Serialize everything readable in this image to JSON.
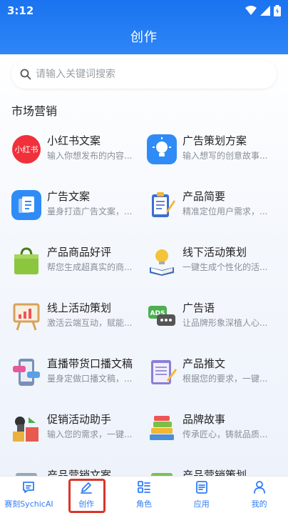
{
  "status_bar": {
    "time": "3:12"
  },
  "header": {
    "title": "创作"
  },
  "search": {
    "placeholder": "请输入关键词搜索"
  },
  "section": {
    "title": "市场营销"
  },
  "cards": [
    {
      "title": "小红书文案",
      "desc": "输入你想发布的内容...",
      "icon": "xiaohongshu-icon",
      "color": "#f0303a",
      "badge": "小红书"
    },
    {
      "title": "广告策划方案",
      "desc": "输入想写的创意故事...",
      "icon": "lightbulb-icon",
      "color": "#2f8cf7"
    },
    {
      "title": "广告文案",
      "desc": "量身打造广告文案，...",
      "icon": "documents-icon",
      "color": "#2f8cf7"
    },
    {
      "title": "产品简要",
      "desc": "精准定位用户需求，...",
      "icon": "clipboard-icon",
      "color": "#3d6fd0"
    },
    {
      "title": "产品商品好评",
      "desc": "帮您生成超真实的商...",
      "icon": "shopping-bag-icon",
      "color": "#8cc63e"
    },
    {
      "title": "线下活动策划",
      "desc": "一键生成个性化的活...",
      "icon": "idea-book-icon",
      "color": "#f3c338"
    },
    {
      "title": "线上活动策划",
      "desc": "激活云端互动，赋能...",
      "icon": "presentation-board-icon",
      "color": "#d9a25a"
    },
    {
      "title": "广告语",
      "desc": "让品牌形象深植人心...",
      "icon": "ads-chat-icon",
      "color": "#4caf50",
      "badge": "ADS"
    },
    {
      "title": "直播带货口播文稿",
      "desc": "量身定做口播文稿，...",
      "icon": "phone-chat-icon",
      "color": "#7a8fb8"
    },
    {
      "title": "产品推文",
      "desc": "根据您的要求，一键...",
      "icon": "notepad-icon",
      "color": "#8b7fd6"
    },
    {
      "title": "促销活动助手",
      "desc": "输入您的需求，一键...",
      "icon": "promotion-icon",
      "color": "#e65a4f"
    },
    {
      "title": "品牌故事",
      "desc": "传承匠心，铸就品质...",
      "icon": "books-icon",
      "color": "#4a8fd8"
    },
    {
      "title": "产品营销文案",
      "desc": "",
      "icon": "product-marketing-icon",
      "color": "#9aa6b8"
    },
    {
      "title": "产品营销策划",
      "desc": "",
      "icon": "marketing-plan-icon",
      "color": "#7cbf58"
    }
  ],
  "bottom_nav": [
    {
      "label": "赛刻SychicAI",
      "icon": "chat-icon"
    },
    {
      "label": "创作",
      "icon": "pencil-icon",
      "active": true
    },
    {
      "label": "角色",
      "icon": "grid-list-icon"
    },
    {
      "label": "应用",
      "icon": "app-list-icon"
    },
    {
      "label": "我的",
      "icon": "person-icon"
    }
  ],
  "colors": {
    "primary": "#1a73f0",
    "nav_blue": "#2f7cf6",
    "highlight": "#d9352b"
  }
}
